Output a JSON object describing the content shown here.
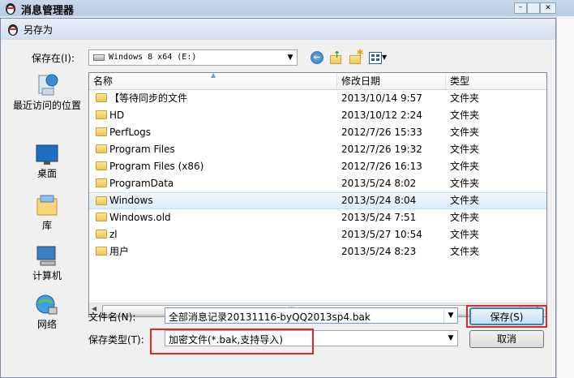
{
  "background_window": {
    "title": "消息管理器"
  },
  "dialog": {
    "title": "另存为",
    "save_in_label": "保存在(I):",
    "location": "Windows 8 x64 (E:)",
    "toolbar_icons": [
      "back-icon",
      "up-folder-icon",
      "new-folder-icon",
      "view-menu-icon"
    ]
  },
  "places": [
    {
      "label": "最近访问的位置",
      "icon": "recent-places-icon"
    },
    {
      "label": "桌面",
      "icon": "desktop-icon"
    },
    {
      "label": "库",
      "icon": "libraries-icon"
    },
    {
      "label": "计算机",
      "icon": "computer-icon"
    },
    {
      "label": "网络",
      "icon": "network-icon"
    }
  ],
  "file_list": {
    "columns": [
      "名称",
      "修改日期",
      "类型"
    ],
    "rows": [
      {
        "name": "【等待同步的文件",
        "date": "2013/10/14 9:57",
        "type": "文件夹"
      },
      {
        "name": "HD",
        "date": "2013/10/12 2:24",
        "type": "文件夹"
      },
      {
        "name": "PerfLogs",
        "date": "2012/7/26 15:33",
        "type": "文件夹"
      },
      {
        "name": "Program Files",
        "date": "2012/7/26 19:32",
        "type": "文件夹"
      },
      {
        "name": "Program Files (x86)",
        "date": "2012/7/26 16:13",
        "type": "文件夹"
      },
      {
        "name": "ProgramData",
        "date": "2013/5/24 8:02",
        "type": "文件夹"
      },
      {
        "name": "Windows",
        "date": "2013/5/24 8:04",
        "type": "文件夹"
      },
      {
        "name": "Windows.old",
        "date": "2013/5/24 7:51",
        "type": "文件夹"
      },
      {
        "name": "zl",
        "date": "2013/5/27 10:54",
        "type": "文件夹"
      },
      {
        "name": "用户",
        "date": "2013/5/24 8:23",
        "type": "文件夹"
      }
    ],
    "selected_row": "Windows"
  },
  "filename": {
    "label": "文件名(N):",
    "value": "全部消息记录20131116-byQQ2013sp4.bak"
  },
  "filetype": {
    "label": "保存类型(T):",
    "value": "加密文件(*.bak,支持导入)"
  },
  "buttons": {
    "save": "保存(S)",
    "cancel": "取消"
  },
  "colors": {
    "highlight_box": "#e0252b",
    "selection": "#dcebfc"
  }
}
